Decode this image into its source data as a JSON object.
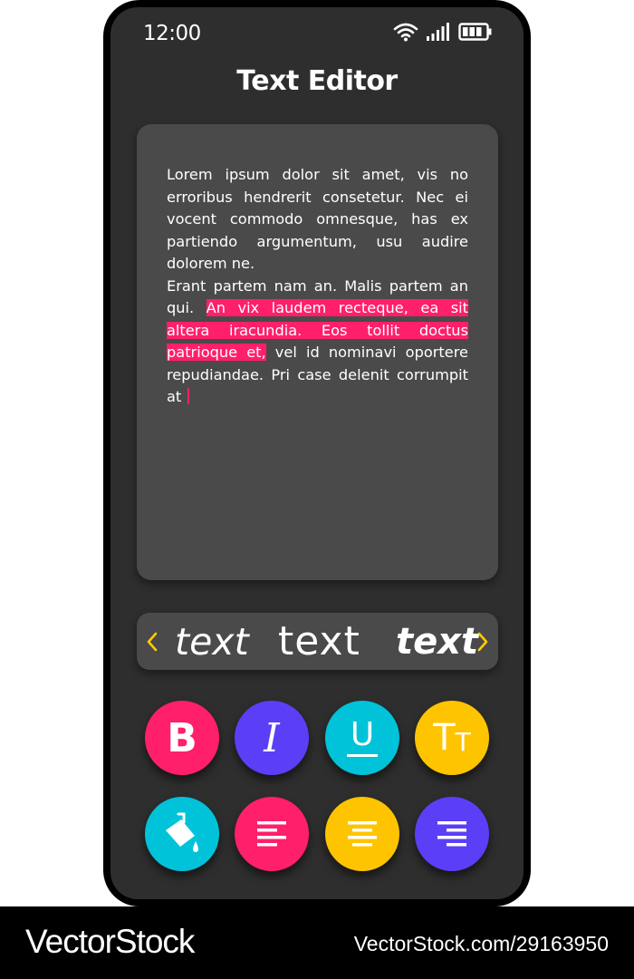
{
  "status_bar": {
    "time": "12:00",
    "icons": [
      "wifi-icon",
      "signal-icon",
      "battery-icon"
    ]
  },
  "app": {
    "title": "Text Editor"
  },
  "editor": {
    "paragraph1": "Lorem ipsum dolor sit amet, vis no erroribus hendrerit consetetur. Nec ei vocent commodo omnesque, has ex partiendo argumentum, usu audire dolorem ne.",
    "paragraph2_before": "Erant partem nam an. Malis partem an qui. ",
    "paragraph2_highlight": "An vix laudem recteque, ea sit altera iracundia. Eos tollit doctus patrioque et,",
    "paragraph2_after": " vel id nominavi oportere repudiandae. Pri case delenit corrumpit at ",
    "highlight_color": "#ff1f6b"
  },
  "font_picker": {
    "options": [
      "text",
      "text",
      "text"
    ],
    "arrow_color": "#ffcc00"
  },
  "format_buttons": {
    "bold_label": "B",
    "italic_label": "I",
    "underline_label": "U",
    "size_label_big": "T",
    "size_label_small": "T",
    "colors": {
      "pink": "#ff1f6b",
      "purple": "#5b3ff6",
      "cyan": "#00c3d9",
      "yellow": "#ffc400"
    }
  },
  "footer": {
    "brand": "VectorStock",
    "url": "VectorStock.com/29163950"
  }
}
